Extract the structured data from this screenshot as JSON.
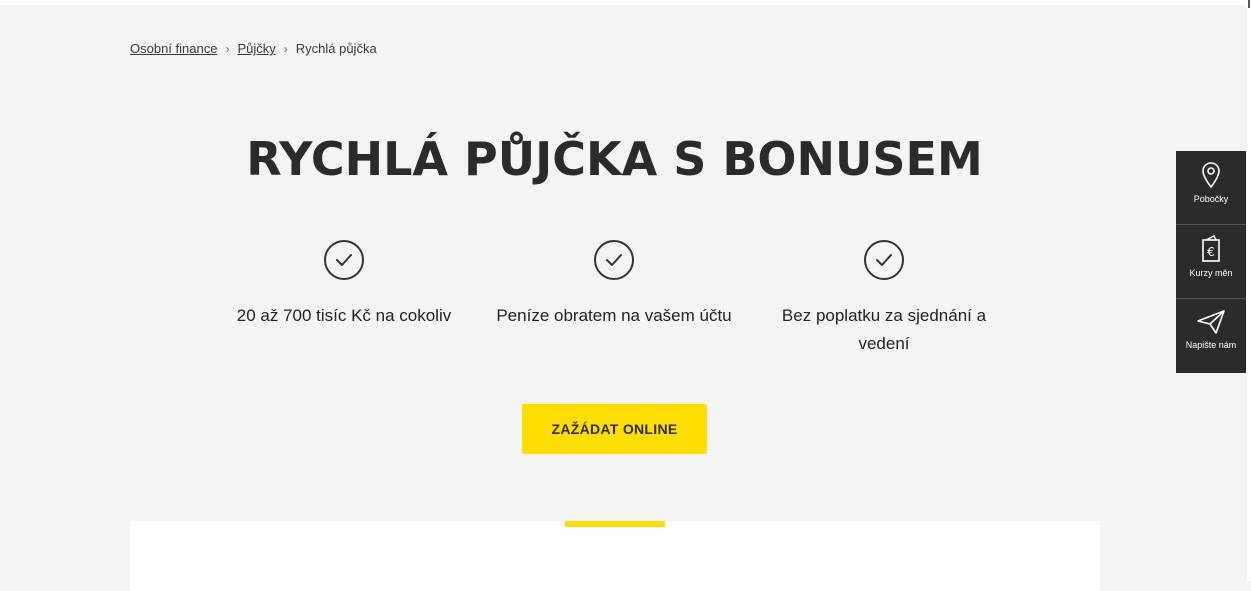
{
  "breadcrumb": {
    "items": [
      {
        "label": "Osobní finance"
      },
      {
        "label": "Půjčky"
      },
      {
        "label": "Rychlá půjčka"
      }
    ],
    "separator": "›"
  },
  "hero": {
    "title": "RYCHLÁ PŮJČKA S BONUSEM",
    "features": [
      {
        "icon": "check-circle-icon",
        "text": "20 až 700 tisíc Kč na cokoliv"
      },
      {
        "icon": "check-circle-icon",
        "text": "Peníze obratem na vašem účtu"
      },
      {
        "icon": "check-circle-icon",
        "text": "Bez poplatku za sjednání a vedení"
      }
    ],
    "cta_label": "ZAŽÁDAT ONLINE"
  },
  "side_widget": {
    "items": [
      {
        "icon": "location-pin-icon",
        "label": "Pobočky"
      },
      {
        "icon": "euro-note-icon",
        "label": "Kurzy měn"
      },
      {
        "icon": "paper-plane-icon",
        "label": "Napište nám"
      }
    ]
  },
  "colors": {
    "background": "#f4f4f4",
    "accent": "#ffdd00",
    "text": "#2b2b2b",
    "widget": "#2b2b2b"
  }
}
